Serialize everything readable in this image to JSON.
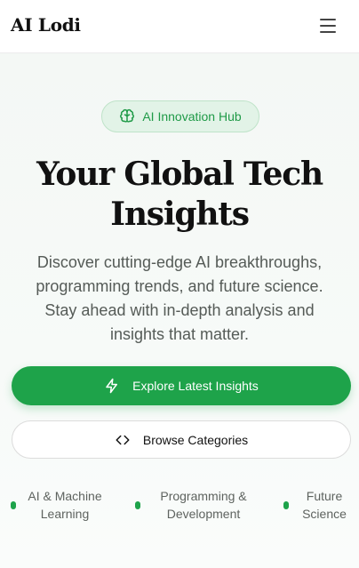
{
  "header": {
    "brand": "AI Lodi",
    "menu_icon": "hamburger-menu-icon"
  },
  "hero": {
    "badge": {
      "icon": "brain-icon",
      "label": "AI Innovation Hub"
    },
    "title": "Your Global Tech Insights",
    "description": "Discover cutting-edge AI breakthroughs, programming trends, and future science. Stay ahead with in-depth analysis and insights that matter.",
    "primary_button": {
      "icon": "lightning-icon",
      "label": "Explore Latest Insights"
    },
    "secondary_button": {
      "icon": "code-icon",
      "label": "Browse Categories"
    },
    "features": [
      {
        "label": "AI & Machine Learning"
      },
      {
        "label": "Programming & Development"
      },
      {
        "label": "Future Science"
      }
    ]
  },
  "colors": {
    "accent": "#1ea34a",
    "badge_bg": "#e2f3e7",
    "text": "#111111",
    "muted_text": "#555b57"
  }
}
